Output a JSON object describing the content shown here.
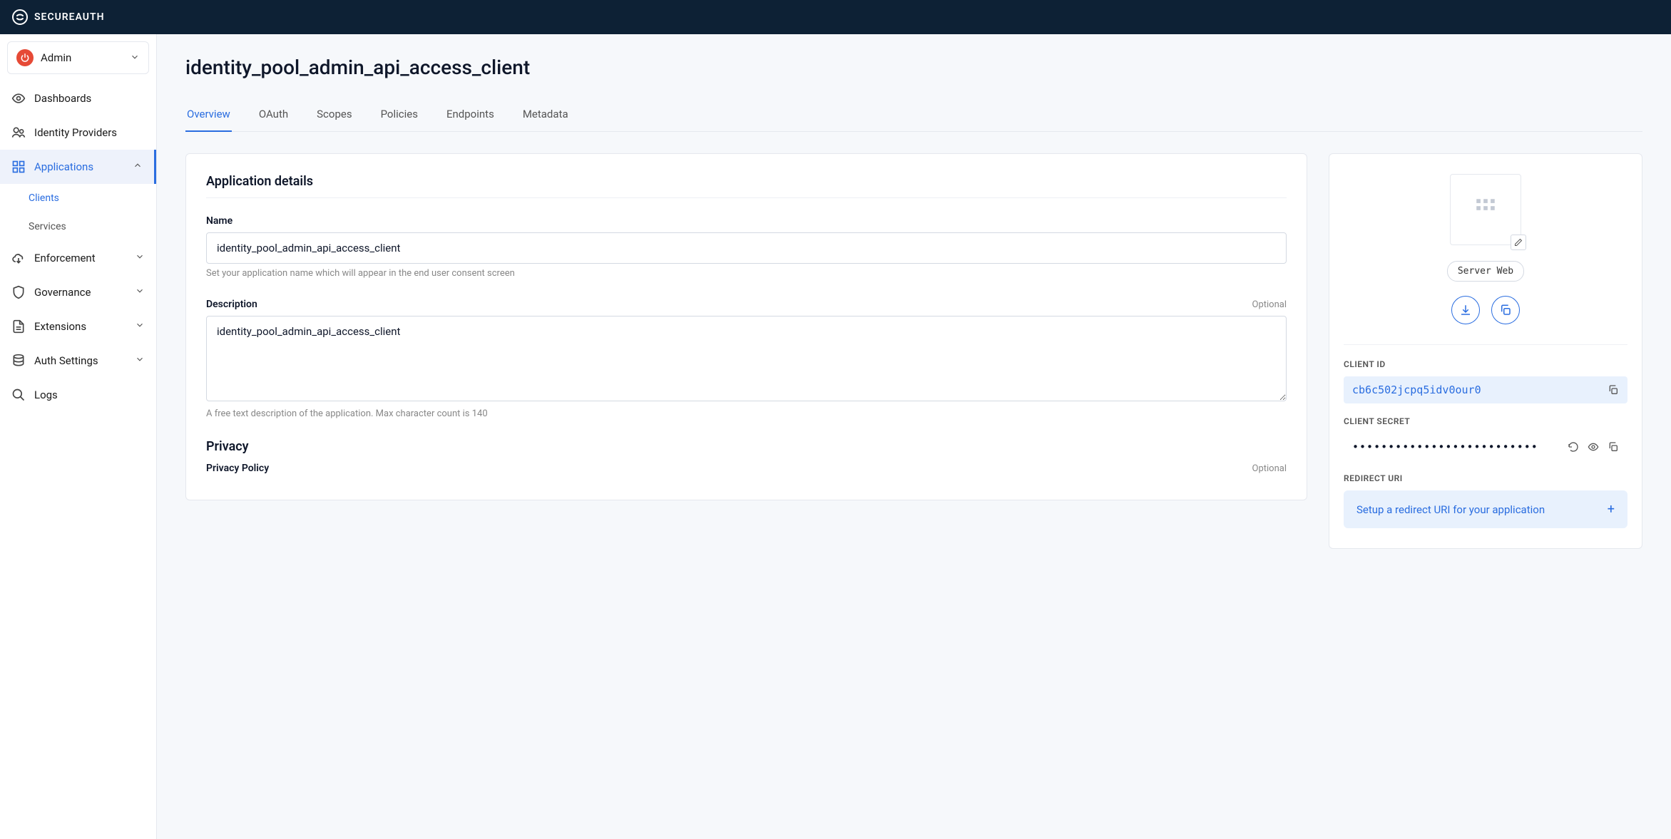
{
  "brand": "SECUREAUTH",
  "admin_select": {
    "label": "Admin"
  },
  "sidebar": {
    "items": [
      {
        "label": "Dashboards"
      },
      {
        "label": "Identity Providers"
      },
      {
        "label": "Applications"
      },
      {
        "label": "Enforcement"
      },
      {
        "label": "Governance"
      },
      {
        "label": "Extensions"
      },
      {
        "label": "Auth Settings"
      },
      {
        "label": "Logs"
      }
    ],
    "sub_applications": [
      {
        "label": "Clients"
      },
      {
        "label": "Services"
      }
    ]
  },
  "page": {
    "title": "identity_pool_admin_api_access_client"
  },
  "tabs": [
    {
      "label": "Overview"
    },
    {
      "label": "OAuth"
    },
    {
      "label": "Scopes"
    },
    {
      "label": "Policies"
    },
    {
      "label": "Endpoints"
    },
    {
      "label": "Metadata"
    }
  ],
  "details": {
    "section_title": "Application details",
    "name": {
      "label": "Name",
      "value": "identity_pool_admin_api_access_client",
      "help": "Set your application name which will appear in the end user consent screen"
    },
    "description": {
      "label": "Description",
      "optional": "Optional",
      "value": "identity_pool_admin_api_access_client",
      "help": "A free text description of the application. Max character count is 140"
    },
    "privacy": {
      "section_title": "Privacy",
      "policy_label": "Privacy Policy",
      "policy_optional": "Optional"
    }
  },
  "side": {
    "tag": "Server Web",
    "client_id_label": "CLIENT ID",
    "client_id": "cb6c502jcpq5idv0our0",
    "client_secret_label": "CLIENT SECRET",
    "client_secret_mask": "••••••••••••••••••••••••••",
    "redirect_label": "REDIRECT URI",
    "redirect_setup": "Setup a redirect URI for your application"
  }
}
